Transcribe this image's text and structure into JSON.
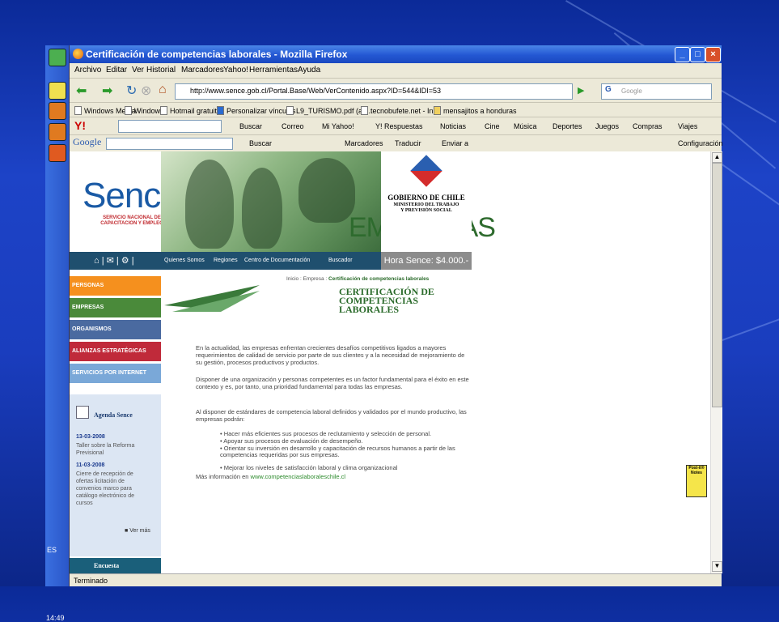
{
  "window": {
    "title": "Certificación de competencias laborales - Mozilla Firefox",
    "status": "Terminado"
  },
  "menubar": [
    "Archivo",
    "Editar",
    "Ver",
    "Historial",
    "Marcadores",
    "Yahoo!",
    "Herramientas",
    "Ayuda"
  ],
  "navbar": {
    "url": "http://www.sence.gob.cl/Portal.Base/Web/VerContenido.aspx?ID=544&IDI=53",
    "search_placeholder": "Google"
  },
  "bookmarks": [
    "Windows Media",
    "Windows",
    "Hotmail gratuito",
    "Personalizar vínculos",
    "L9_TURISMO.pdf (ap...",
    "tecnobufete.net - In...",
    "mensajitos a honduras"
  ],
  "yahoo_toolbar": {
    "search": "Buscar",
    "items": [
      "Correo",
      "Mi Yahoo!",
      "Y! Respuestas",
      "Noticias",
      "Cine",
      "Música",
      "Deportes",
      "Juegos",
      "Compras",
      "Viajes"
    ]
  },
  "google_toolbar": {
    "logo": "Google",
    "items": [
      "Buscar",
      "Marcadores",
      "Traducir",
      "Enviar a"
    ],
    "settings": "Configuración"
  },
  "banner": {
    "logo": "Sence",
    "logo_sub": "SERVICIO NACIONAL DE CAPACITACION Y EMPLEO",
    "section": "EMPRESAS",
    "gob_line1": "GOBIERNO DE CHILE",
    "gob_line2": "MINISTERIO DEL TRABAJO",
    "gob_line3": "Y PREVISIÓN SOCIAL",
    "nav_links": [
      "Quienes Somos",
      "Regiones",
      "Centro de Documentación",
      "Buscador"
    ],
    "hora": "Hora Sence: $4.000.-"
  },
  "left_menu": [
    {
      "label": "PERSONAS",
      "color": "#f5901e"
    },
    {
      "label": "EMPRESAS",
      "color": "#4a8a3a"
    },
    {
      "label": "ORGANISMOS CAPACITADORES",
      "color": "#4a6aa0"
    },
    {
      "label": "ALIANZAS ESTRATÉGICAS",
      "color": "#c02a3a"
    },
    {
      "label": "SERVICIOS POR INTERNET",
      "color": "#7aa8d8"
    }
  ],
  "agenda": {
    "title": "Agenda Sence",
    "items": [
      {
        "date": "13-03-2008",
        "text": "Taller sobre la Reforma Previsional"
      },
      {
        "date": "11-03-2008",
        "text": "Cierre de recepción de ofertas licitación de convenios marco para catálogo electrónico de cursos"
      }
    ],
    "more": "Ver más",
    "encuesta": "Encuesta"
  },
  "breadcrumb": {
    "home": "Inicio : Empresa : ",
    "current": "Certificación de competencias laborales"
  },
  "article": {
    "title": "CERTIFICACIÓN DE COMPETENCIAS LABORALES",
    "p1": "En la actualidad, las empresas enfrentan crecientes desafíos competitivos ligados a mayores requerimientos de calidad de servicio por parte de sus clientes y a la necesidad de mejoramiento de su gestión, procesos productivos y productos.",
    "p2": "Disponer de una organización y personas competentes es un factor fundamental para el éxito en este contexto y es, por tanto, una prioridad fundamental para todas las empresas.",
    "p3": "Al disponer de estándares de competencia laboral definidos y validados por el mundo productivo, las empresas podrán:",
    "bullets": [
      "Hacer más eficientes sus procesos de reclutamiento y selección de personal.",
      "Apoyar sus procesos de evaluación de desempeño.",
      "Orientar su inversión en desarrollo y capacitación de recursos humanos a partir de las competencias requeridas por sus empresas.",
      "Mejorar los niveles de satisfacción laboral y clima organizacional"
    ],
    "more_info": "Más información en ",
    "more_link": "www.competenciaslaboraleschile.cl"
  },
  "postit": "Post-it® Notes",
  "taskbar": {
    "lang": "ES",
    "time": "14:49"
  }
}
